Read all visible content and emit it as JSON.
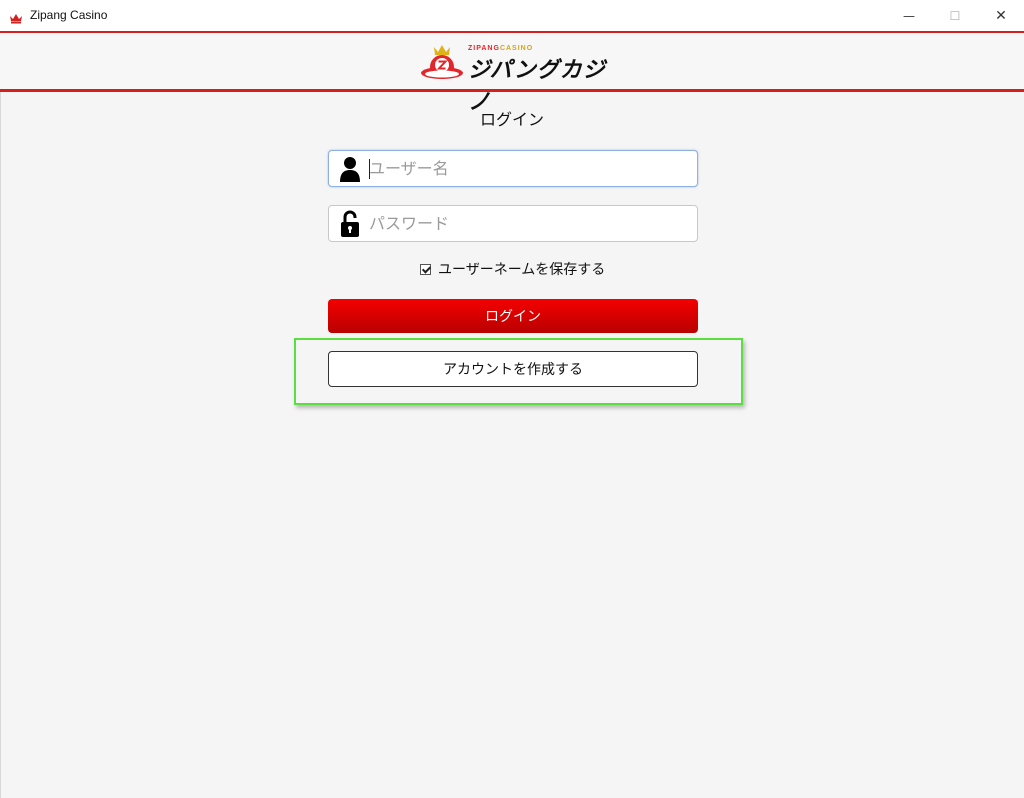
{
  "window": {
    "title": "Zipang Casino",
    "minimize_glyph": "—",
    "maximize_glyph": "☐",
    "close_glyph": "✕"
  },
  "logo": {
    "small_text_red": "ZIPANG",
    "small_text_gold": "CASINO",
    "main_text": "ジパングカジノ"
  },
  "login": {
    "title": "ログイン",
    "username_placeholder": "ユーザー名",
    "password_placeholder": "パスワード",
    "remember_label": "ユーザーネームを保存する",
    "remember_checked": true,
    "login_button": "ログイン",
    "create_account_button": "アカウントを作成する"
  },
  "icons": {
    "app": "casino-crown-icon",
    "username": "user-icon",
    "password": "padlock-icon",
    "emblem": "crown-z-emblem-icon"
  },
  "colors": {
    "brand_red": "#d61f1f",
    "button_red_top": "#f50000",
    "button_red_bottom": "#b80000",
    "highlight_green": "#5bde3f",
    "logo_gold": "#d4a514"
  }
}
